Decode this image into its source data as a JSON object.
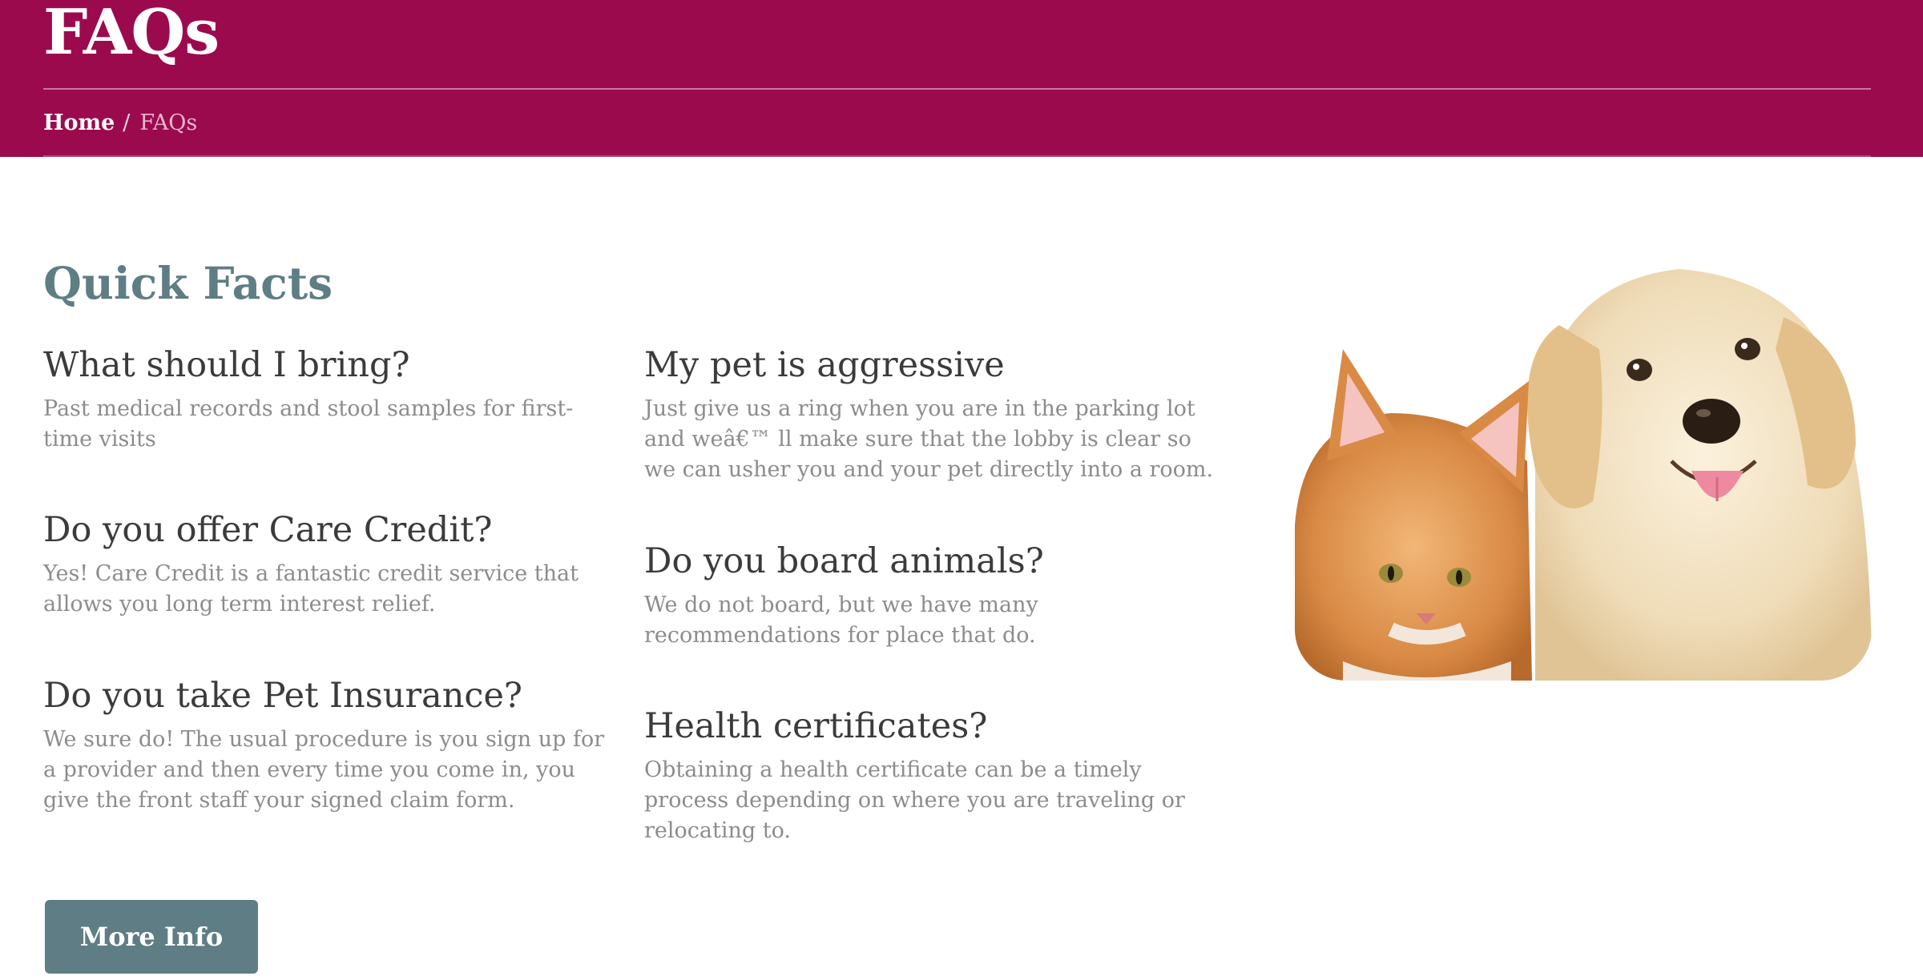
{
  "hero": {
    "title": "FAQs",
    "breadcrumb": {
      "home": "Home",
      "separator": "/",
      "current": "FAQs"
    }
  },
  "quick_facts": {
    "title": "Quick Facts",
    "left_column": [
      {
        "question": "What should I bring?",
        "answer": "Past medical records and stool samples for first-time visits"
      },
      {
        "question": "Do you offer Care Credit?",
        "answer": "Yes! Care Credit is a fantastic credit service that allows you long term interest relief."
      },
      {
        "question": "Do you take Pet Insurance?",
        "answer": "We sure do! The usual procedure is you sign up for a provider and then every time you come in, you give the front staff your signed claim form."
      }
    ],
    "right_column": [
      {
        "question": "My pet is aggressive",
        "answer": "Just give us a ring when you are in the parking lot and weâ€™ ll make sure that the lobby is clear so we can usher you and your pet directly into a room."
      },
      {
        "question": "Do you board animals?",
        "answer": "We do not board, but we have many recommendations for place that do."
      },
      {
        "question": "Health certificates?",
        "answer": "Obtaining a health certificate can be a timely process depending on where you are traveling or relocating to."
      }
    ],
    "button_label": "More Info"
  },
  "image": {
    "subject": "kitten-and-puppy-photo"
  },
  "colors": {
    "brand": "#9c0a4e",
    "accent": "#5f7d84",
    "heading": "#3b3b3b",
    "body_text": "#8c8c8c"
  }
}
